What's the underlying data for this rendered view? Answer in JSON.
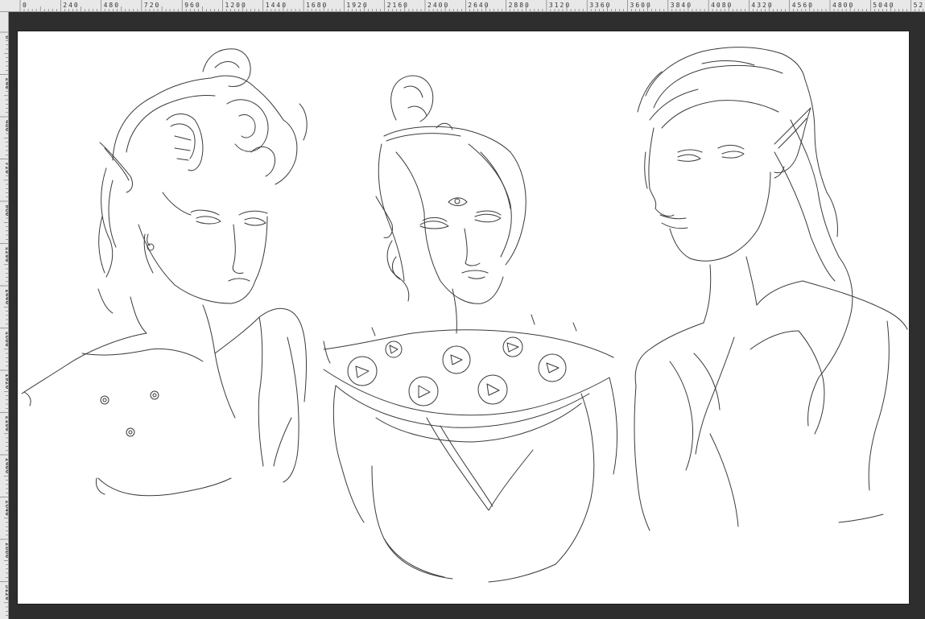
{
  "rulers": {
    "horizontal_labels": [
      "0",
      "240",
      "480",
      "720",
      "960",
      "1200",
      "1440",
      "1680",
      "1920",
      "2160",
      "2400",
      "2640",
      "2880",
      "3120",
      "3360",
      "3600",
      "3840",
      "4080",
      "4320",
      "4560",
      "4800",
      "5040",
      "52"
    ],
    "vertical_labels": [
      "0",
      "240",
      "480",
      "720",
      "960",
      "1200",
      "1440",
      "1680",
      "1920",
      "2160",
      "2400",
      "2640",
      "2880",
      "3120"
    ],
    "units": "px"
  },
  "canvas": {
    "background": "#ffffff",
    "stroke_color": "#3a3a3a",
    "artwork": "pencil-sketch-three-elf-portraits"
  },
  "colors": {
    "workspace": "#2e2e2e",
    "ruler_bg": "#e8e8e8",
    "ruler_text": "#333333"
  }
}
